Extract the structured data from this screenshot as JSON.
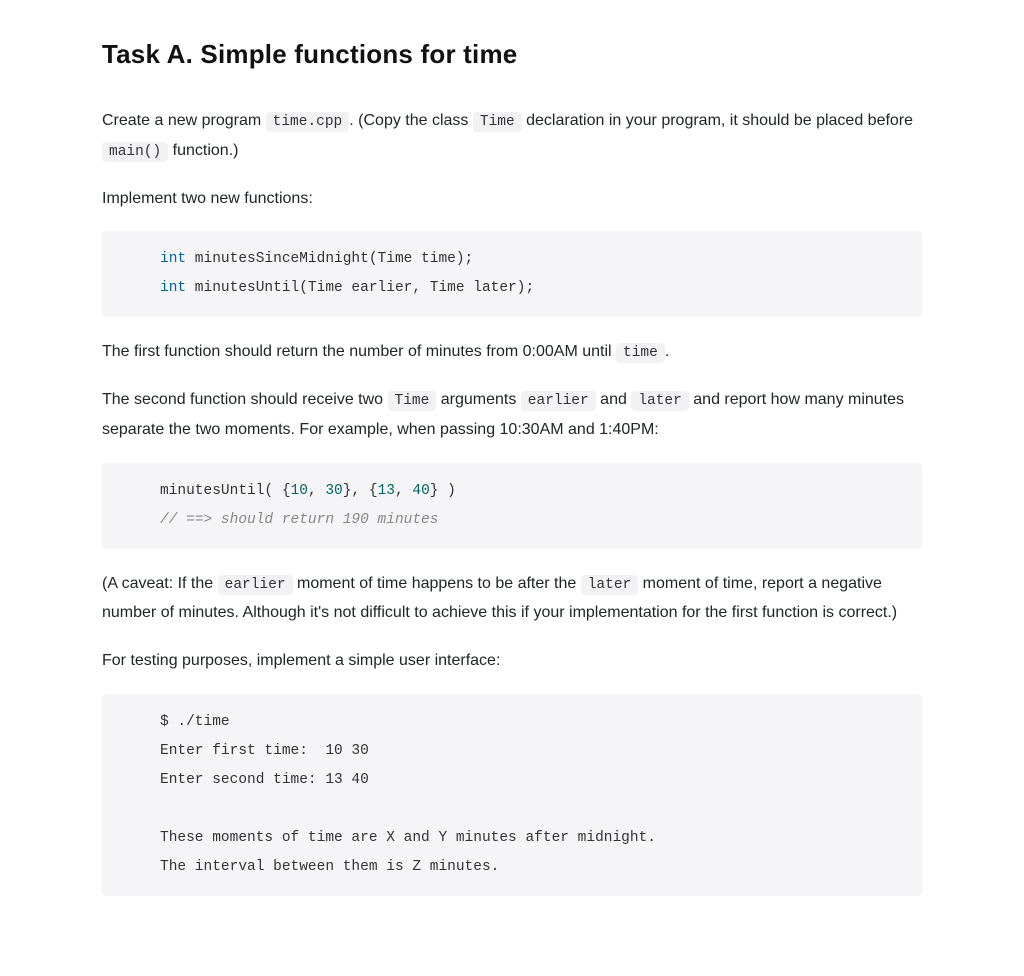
{
  "heading": "Task A. Simple functions for time",
  "p1_a": "Create a new program ",
  "p1_code1": "time.cpp",
  "p1_b": ". (Copy the class ",
  "p1_code2": "Time",
  "p1_c": " declaration in your program, it should be placed before ",
  "p1_code3": "main()",
  "p1_d": " function.)",
  "p2": "Implement two new functions:",
  "code1": {
    "kw1": "int",
    "rest1": " minutesSinceMidnight(Time time);",
    "kw2": "int",
    "rest2": " minutesUntil(Time earlier, Time later);"
  },
  "p3_a": "The first function should return the number of minutes from 0:00AM until ",
  "p3_code1": "time",
  "p3_b": ".",
  "p4_a": "The second function should receive two ",
  "p4_code1": "Time",
  "p4_b": " arguments ",
  "p4_code2": "earlier",
  "p4_c": " and ",
  "p4_code3": "later",
  "p4_d": " and report how many minutes separate the two moments. For example, when passing 10:30AM and 1:40PM:",
  "code2": {
    "l1_a": "minutesUntil( {",
    "l1_n1": "10",
    "l1_b": ", ",
    "l1_n2": "30",
    "l1_c": "}, {",
    "l1_n3": "13",
    "l1_d": ", ",
    "l1_n4": "40",
    "l1_e": "} )",
    "l2_cmt": "// ==> should return 190 minutes"
  },
  "p5_a": "(A caveat: If the ",
  "p5_code1": "earlier",
  "p5_b": " moment of time happens to be after the ",
  "p5_code2": "later",
  "p5_c": " moment of time, report a negative number of minutes. Although it's not difficult to achieve this if your implementation for the first function is correct.)",
  "p6": "For testing purposes, implement a simple user interface:",
  "code3": "$ ./time\nEnter first time:  10 30\nEnter second time: 13 40\n\nThese moments of time are X and Y minutes after midnight.\nThe interval between them is Z minutes."
}
